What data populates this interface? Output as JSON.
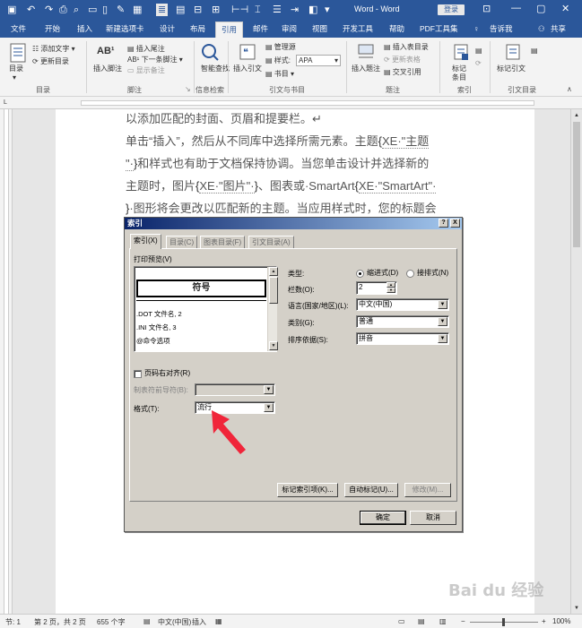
{
  "titlebar": {
    "title": "Word - Word",
    "login_label": "登录",
    "window_minimize": "—",
    "window_restore": "▢",
    "window_close": "✕"
  },
  "menu": {
    "file": "文件",
    "tabs": [
      "开始",
      "插入",
      "新建选项卡",
      "设计",
      "布局",
      "引用",
      "邮件",
      "审阅",
      "视图",
      "开发工具",
      "帮助",
      "PDF工具集"
    ],
    "active_tab": "引用",
    "tell_me": "告诉我",
    "share": "共享"
  },
  "ribbon": {
    "toc": {
      "button": "目录",
      "add_text": "添加文字",
      "update": "更新目录",
      "group": "目录"
    },
    "footnotes": {
      "insert_footnote": "插入脚注",
      "insert_endnote": "插入尾注",
      "next_footnote": "下一条脚注",
      "show_notes": "显示备注",
      "group": "脚注"
    },
    "research": {
      "smart_lookup": "智能查找",
      "group": "信息检索"
    },
    "citations": {
      "insert_citation": "插入引文",
      "manage_sources": "管理源",
      "style_label": "样式:",
      "style_value": "APA",
      "bibliography": "书目",
      "group": "引文与书目"
    },
    "captions": {
      "insert_caption": "插入题注",
      "insert_table_of_figures": "插入表目录",
      "update_table": "更新表格",
      "cross_reference": "交叉引用",
      "group": "题注"
    },
    "index": {
      "mark_entry": "标记条目",
      "group": "索引"
    },
    "toa": {
      "mark_citation": "标记引文",
      "group": "引文目录"
    }
  },
  "document": {
    "line1": "以添加匹配的封面、页眉和提要栏。↵",
    "line2a": "单击“插入”，然后从不同库中选择所需元素。主题",
    "line2_xe": "XE·\"主题",
    "line3_xe": "\"·",
    "line3": "和样式也有助于文档保持协调。当您单击设计并选择新的",
    "line4a": "主题时，图片",
    "line4_xe": "XE·\"图片\"·",
    "line4b": "、图表或·SmartArt",
    "line4_xe2": "XE·\"SmartArt\"·",
    "line5": "·图形将会更改以匹配新的主题。当应用样式时，您的标题会"
  },
  "dialog": {
    "title": "索引",
    "help_btn": "?",
    "close_btn": "X",
    "tabs": [
      "索引(X)",
      "目录(C)",
      "图表目录(F)",
      "引文目录(A)"
    ],
    "print_preview_label": "打印预览(V)",
    "preview_heading": "符号",
    "preview_entries": [
      ".DOT 文件名, 2",
      ".INI 文件名, 3",
      "@命令选项"
    ],
    "right_align_label": "页码右对齐(R)",
    "tab_leader_label": "制表符前导符(B):",
    "format_label": "格式(T):",
    "format_value": "流行",
    "type_label": "类型:",
    "type_indent": "缩进式(D)",
    "type_runin": "接排式(N)",
    "columns_label": "栏数(O):",
    "columns_value": "2",
    "language_label": "语言(国家/地区)(L):",
    "language_value": "中文(中国)",
    "category_label": "类别(G):",
    "category_value": "普通",
    "sort_label": "排序依据(S):",
    "sort_value": "拼音",
    "mark_entry_btn": "标记索引项(K)...",
    "automark_btn": "自动标记(U)...",
    "modify_btn": "修改(M)...",
    "ok_btn": "确定",
    "cancel_btn": "取消"
  },
  "status": {
    "section": "节: 1",
    "page": "第 2 页，共 2 页",
    "words": "655 个字",
    "language": "中文(中国)",
    "mode": "插入",
    "zoom": "100%"
  },
  "watermark": "Bai du 经验"
}
